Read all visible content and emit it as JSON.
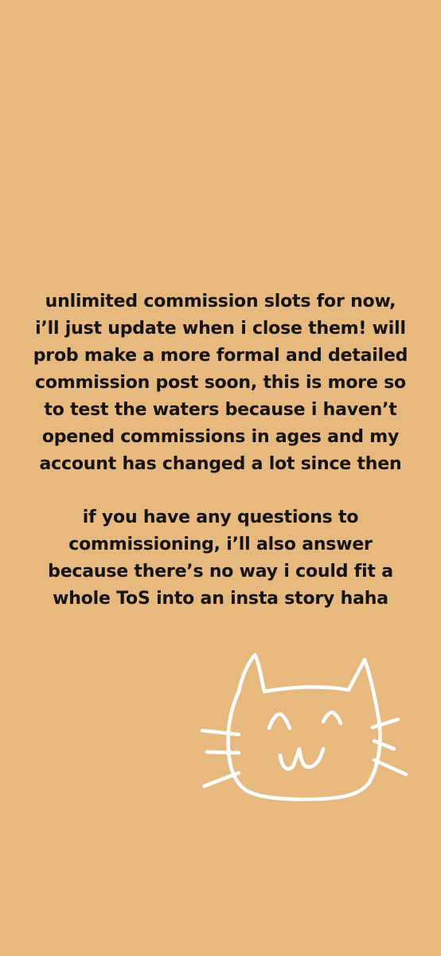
{
  "story": {
    "background": "#E8B97F",
    "text_color": "#141414",
    "paragraph1": [
      "unlimited commission slots for now,",
      "i’ll just update when i close them! will",
      "prob make a more formal and detailed",
      "commission post soon, this is more so",
      "to test the waters because i haven’t",
      "opened commissions in ages and my",
      "account has changed a lot since then"
    ],
    "paragraph2": [
      "if you have any questions to",
      "commissioning, i’ll also answer",
      "because there’s no way i could fit a",
      "whole ToS into an insta story haha"
    ],
    "drawing": {
      "icon": "cat-doodle-icon",
      "stroke_color": "#FFFFFF"
    }
  }
}
